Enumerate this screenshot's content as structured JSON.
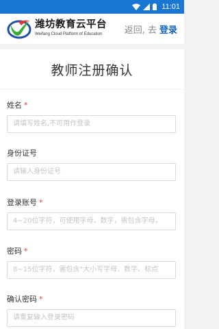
{
  "status_bar": {
    "time": "11:01"
  },
  "header": {
    "brand_cn": "潍坊教育云平台",
    "brand_en": "Weifang Cloud Platform of Education",
    "back_text": "返回, 去",
    "login_label": "登录"
  },
  "page": {
    "title": "教师注册确认"
  },
  "form": {
    "fields": [
      {
        "label": "姓名",
        "required": "*",
        "placeholder": "请填写姓名,不可用作登录"
      },
      {
        "label": "身份证号",
        "required": "",
        "placeholder": "请输入身份证号"
      },
      {
        "label": "登录账号",
        "required": "*",
        "placeholder": "4~20位字符，可使用字母、数字，需包含字母，"
      },
      {
        "label": "密码",
        "required": "*",
        "placeholder": "8~15位字符，需包含\"大小写字母、数字、标点"
      },
      {
        "label": "确认密码",
        "required": "*",
        "placeholder": "请重复输入登录密码"
      }
    ]
  },
  "colors": {
    "status_bar": "#1976d2",
    "accent": "#1565c0",
    "required": "#e53935"
  }
}
